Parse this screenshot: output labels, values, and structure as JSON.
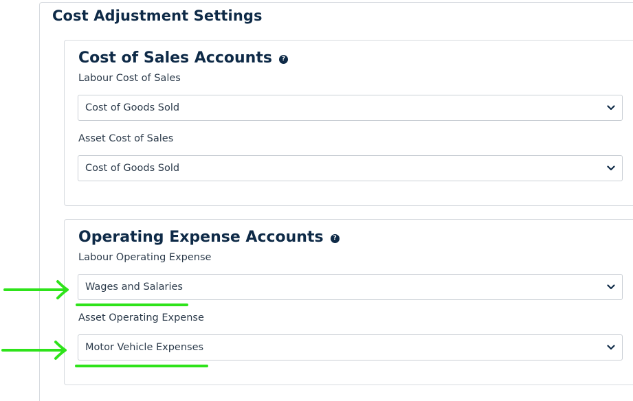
{
  "page": {
    "title": "Cost Adjustment Settings"
  },
  "cost_of_sales": {
    "title": "Cost of Sales Accounts",
    "help_icon": "question-circle-icon",
    "labour_label": "Labour Cost of Sales",
    "labour_value": "Cost of Goods Sold",
    "asset_label": "Asset Cost of Sales",
    "asset_value": "Cost of Goods Sold"
  },
  "operating_expense": {
    "title": "Operating Expense Accounts",
    "help_icon": "question-circle-icon",
    "labour_label": "Labour Operating Expense",
    "labour_value": "Wages and Salaries",
    "asset_label": "Asset Operating Expense",
    "asset_value": "Motor Vehicle Expenses"
  },
  "annotations": {
    "arrow_color": "#2ee31a",
    "arrow_icon": "arrow-right-icon"
  },
  "colors": {
    "heading": "#0e2a47",
    "border": "#d6dadf",
    "highlight": "#2ee31a"
  }
}
